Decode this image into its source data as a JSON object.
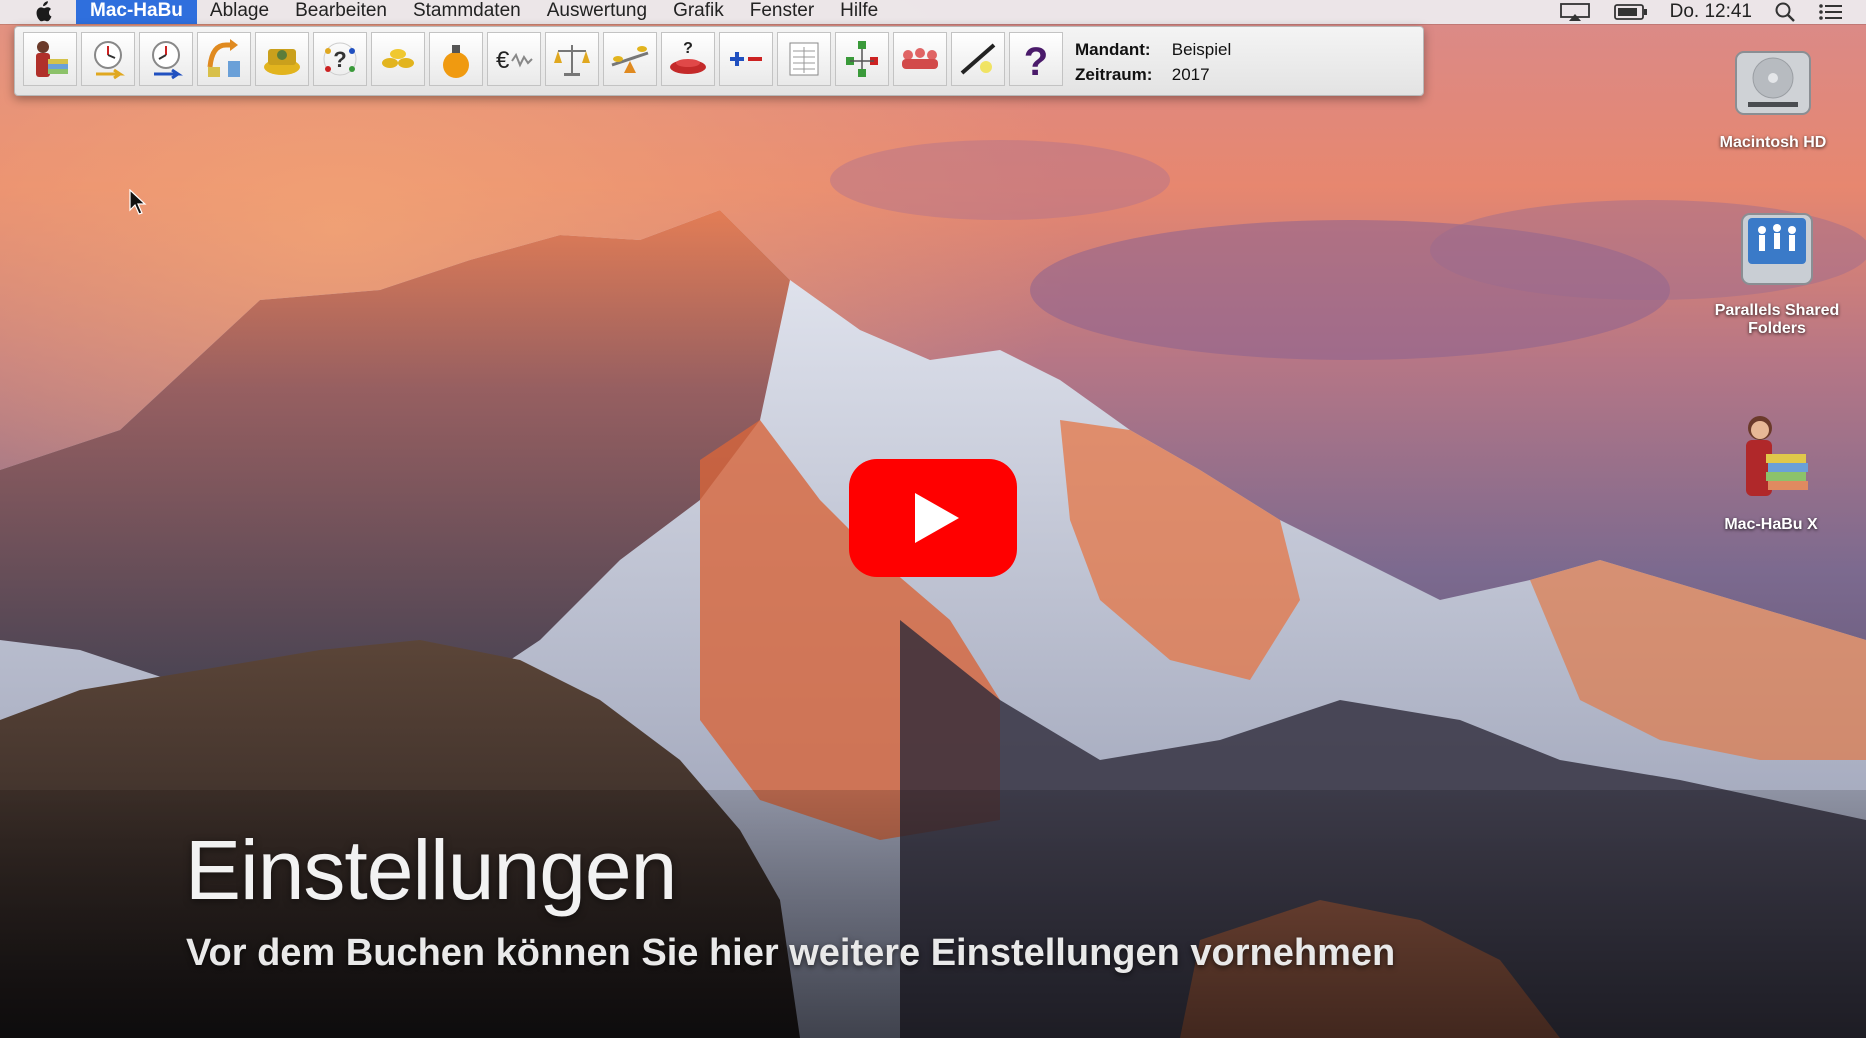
{
  "menubar": {
    "items": [
      "Mac-HaBu",
      "Ablage",
      "Bearbeiten",
      "Stammdaten",
      "Auswertung",
      "Grafik",
      "Fenster",
      "Hilfe"
    ],
    "clock": "Do. 12:41"
  },
  "toolbar": {
    "tools": [
      "person-books-icon",
      "clock-in-icon",
      "clock-out-icon",
      "exchange-icon",
      "cash-register-icon",
      "question-dots-icon",
      "coins-icon",
      "money-bag-icon",
      "euro-chart-icon",
      "scale-icon",
      "seesaw-icon",
      "question-pot-icon",
      "plus-minus-icon",
      "ledger-sheet-icon",
      "tree-chart-icon",
      "people-group-icon",
      "pen-icon",
      "help-icon"
    ],
    "mandant_label": "Mandant:",
    "mandant_value": "Beispiel",
    "zeitraum_label": "Zeitraum:",
    "zeitraum_value": "2017"
  },
  "desktop": {
    "icons": [
      {
        "label": "Macintosh HD"
      },
      {
        "label": "Parallels Shared Folders"
      },
      {
        "label": "Mac-HaBu X"
      }
    ]
  },
  "video": {
    "title": "Einstellungen",
    "subtitle": "Vor dem Buchen können Sie hier weitere Einstellungen vornehmen"
  },
  "colors": {
    "menu_highlight": "#2f6fdd",
    "play_red": "#ff0000"
  }
}
